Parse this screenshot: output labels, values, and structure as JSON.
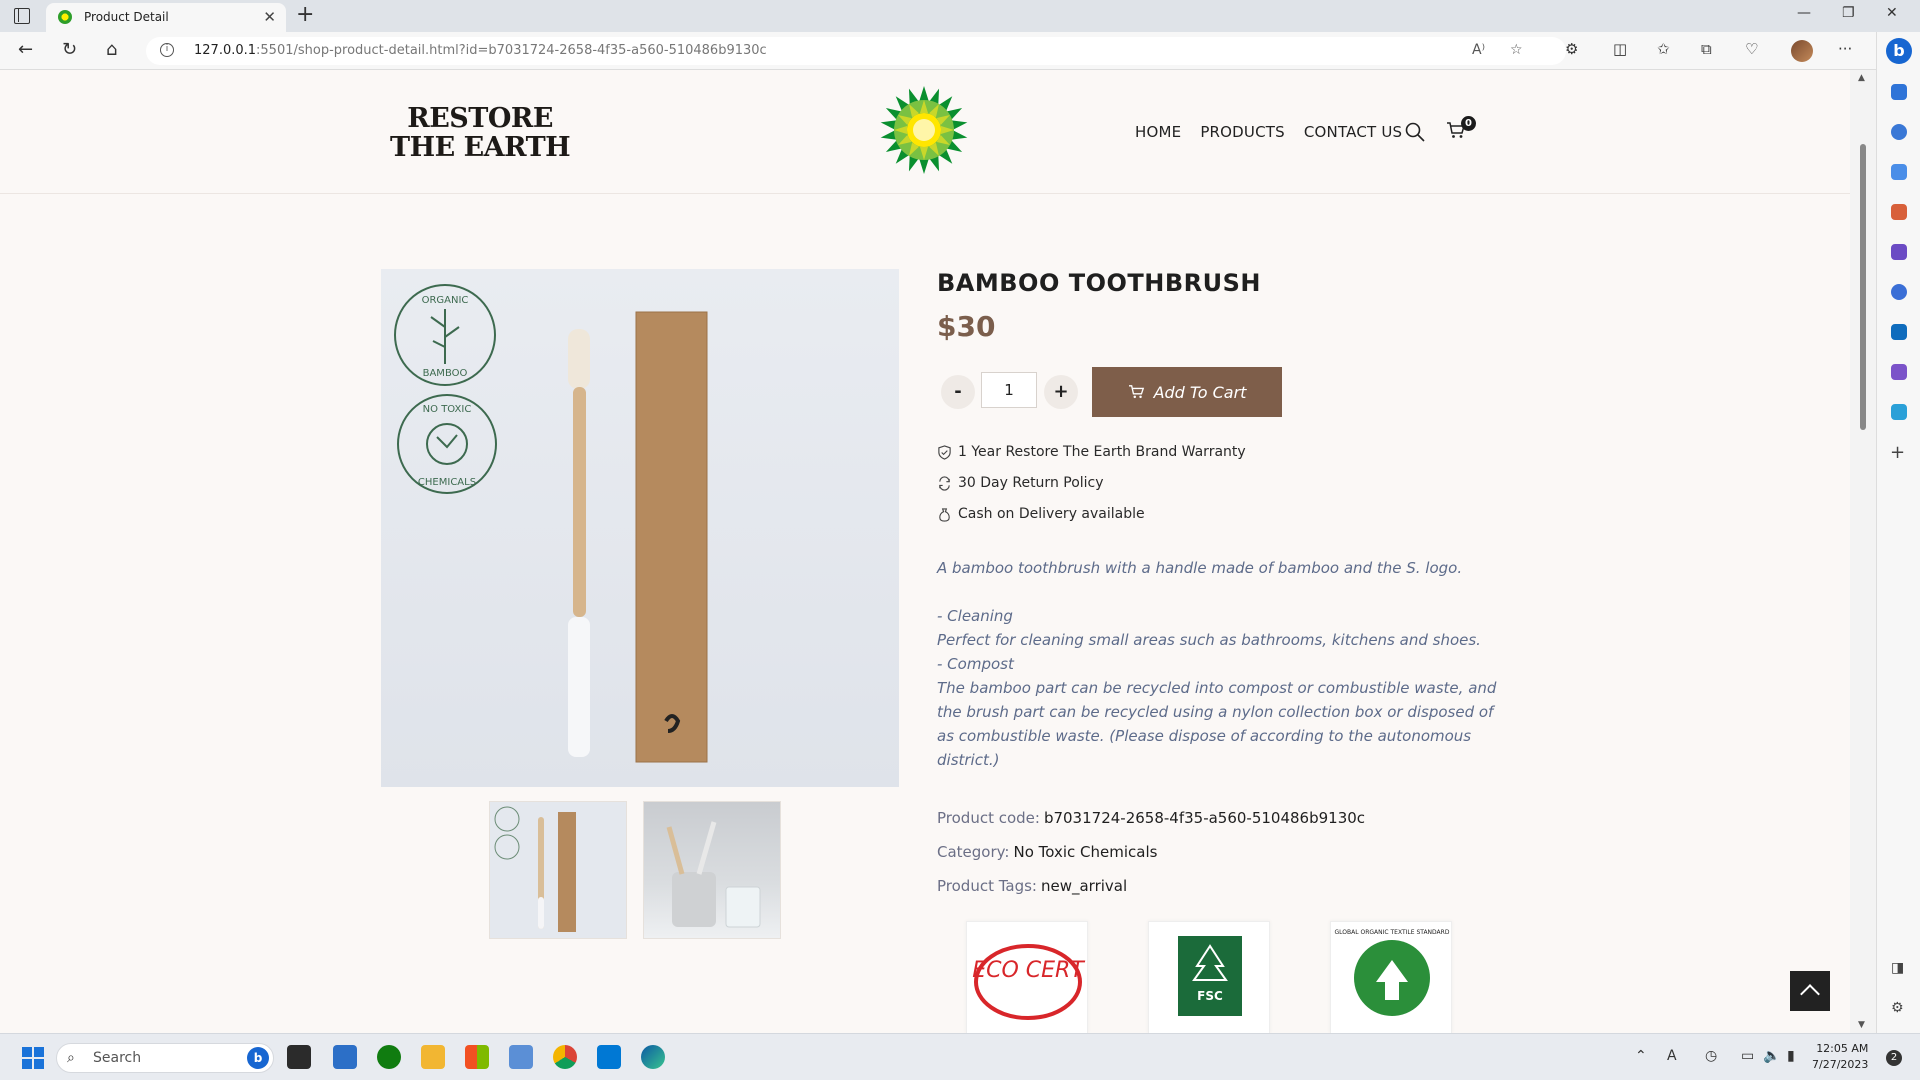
{
  "browser": {
    "tab_title": "Product Detail",
    "url_host": "127.0.0.1",
    "url_rest": ":5501/shop-product-detail.html?id=b7031724-2658-4f35-a560-510486b9130c"
  },
  "site": {
    "logo_line1": "RESTORE",
    "logo_line2": "THE EARTH",
    "nav": [
      "HOME",
      "PRODUCTS",
      "CONTACT US"
    ],
    "cart_count": "0"
  },
  "product": {
    "title": "BAMBOO TOOTHBRUSH",
    "price": "$30",
    "qty_minus": "-",
    "qty_value": "1",
    "qty_plus": "+",
    "add_to_cart": "Add To Cart",
    "features": [
      "1 Year Restore The Earth Brand Warranty",
      "30 Day Return Policy",
      "Cash on Delivery available"
    ],
    "description": {
      "intro": "A bamboo toothbrush with a handle made of bamboo and the S. logo.",
      "heading1": "- Cleaning",
      "text1": "Perfect for cleaning small areas such as bathrooms, kitchens and shoes.",
      "heading2": "- Compost",
      "text2": "The bamboo part can be recycled into compost or combustible waste, and the brush part can be recycled using a nylon collection box or disposed of as combustible waste. (Please dispose of according to the autonomous district.)"
    },
    "code_label": "Product code:",
    "code_value": "b7031724-2658-4f35-a560-510486b9130c",
    "category_label": "Category:",
    "category_value": "No Toxic Chemicals",
    "tags_label": "Product Tags:",
    "tags_value": "new_arrival",
    "image_badges": {
      "badge1_top": "ORGANIC",
      "badge1_bottom": "BAMBOO",
      "badge2_top": "NO TOXIC",
      "badge2_bottom": "CHEMICALS"
    },
    "certs": [
      "ECO CERT",
      "FSC",
      "GLOBAL ORGANIC TEXTILE STANDARD"
    ]
  },
  "taskbar": {
    "search_placeholder": "Search",
    "time": "12:05 AM",
    "date": "7/27/2023",
    "notifications": "2"
  },
  "colors": {
    "brand_brown": "#7e5e4a",
    "price_brown": "#7b5e4c",
    "desc_text": "#5d6b8a"
  }
}
